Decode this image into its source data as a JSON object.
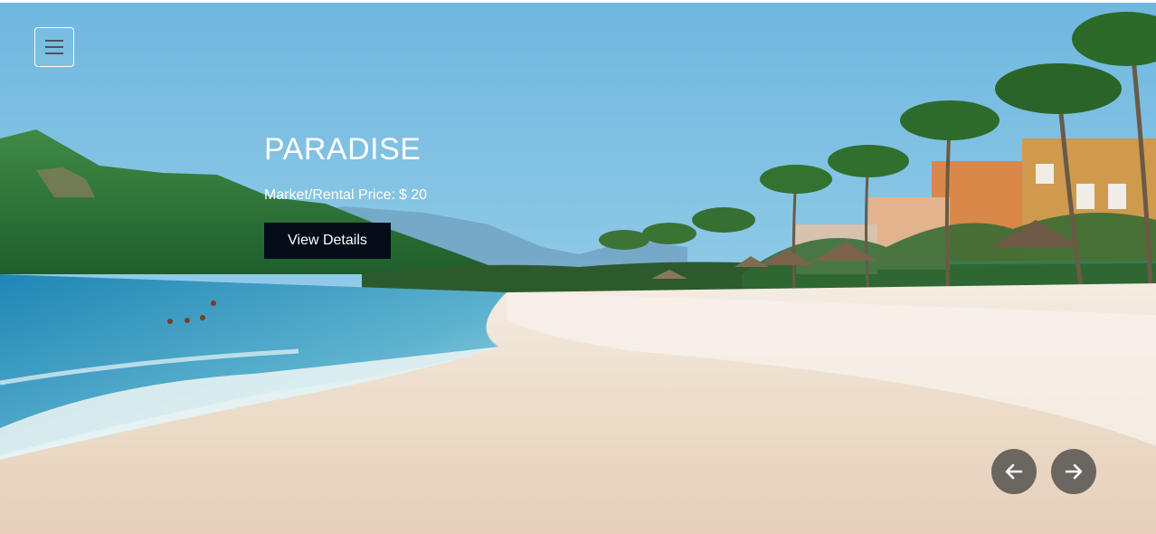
{
  "menu": {
    "icon": "menu-icon"
  },
  "slide": {
    "title": "PARADISE",
    "price_label": "Market/Rental Price:",
    "price_value": "$ 20",
    "cta_label": "View Details"
  },
  "carousel": {
    "prev_icon": "arrow-left-icon",
    "next_icon": "arrow-right-icon"
  },
  "colors": {
    "button_dark": "#030c17",
    "nav_circle": "#5a5652",
    "sky": "#7fc0e2",
    "sand": "#eadbc9",
    "sea": "#2f8fb8"
  }
}
